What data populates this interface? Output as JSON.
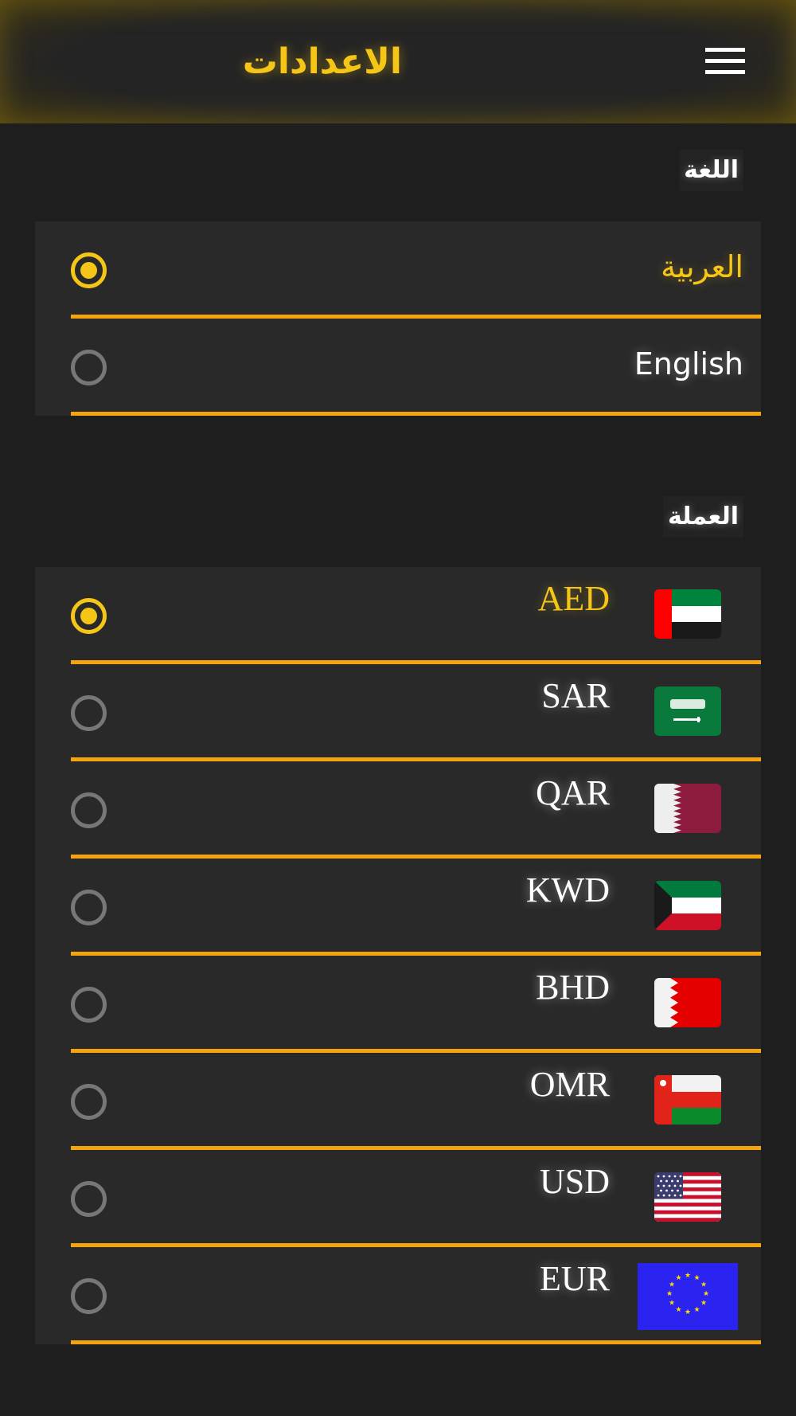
{
  "header": {
    "title": "الاعدادات",
    "menu_icon": "hamburger-menu-icon"
  },
  "language": {
    "label": "اللغة",
    "options": [
      {
        "label": "العربية",
        "selected": true
      },
      {
        "label": "English",
        "selected": false
      }
    ]
  },
  "currency": {
    "label": "العملة",
    "options": [
      {
        "code": "AED",
        "flag": "uae-flag-icon",
        "selected": true
      },
      {
        "code": "SAR",
        "flag": "saudi-flag-icon",
        "selected": false
      },
      {
        "code": "QAR",
        "flag": "qatar-flag-icon",
        "selected": false
      },
      {
        "code": "KWD",
        "flag": "kuwait-flag-icon",
        "selected": false
      },
      {
        "code": "BHD",
        "flag": "bahrain-flag-icon",
        "selected": false
      },
      {
        "code": "OMR",
        "flag": "oman-flag-icon",
        "selected": false
      },
      {
        "code": "USD",
        "flag": "usa-flag-icon",
        "selected": false
      },
      {
        "code": "EUR",
        "flag": "eu-flag-icon",
        "selected": false
      }
    ]
  },
  "colors": {
    "accent": "#f5c518",
    "divider": "#f5a30f",
    "background": "#1e1e1e",
    "panel": "#292929"
  }
}
